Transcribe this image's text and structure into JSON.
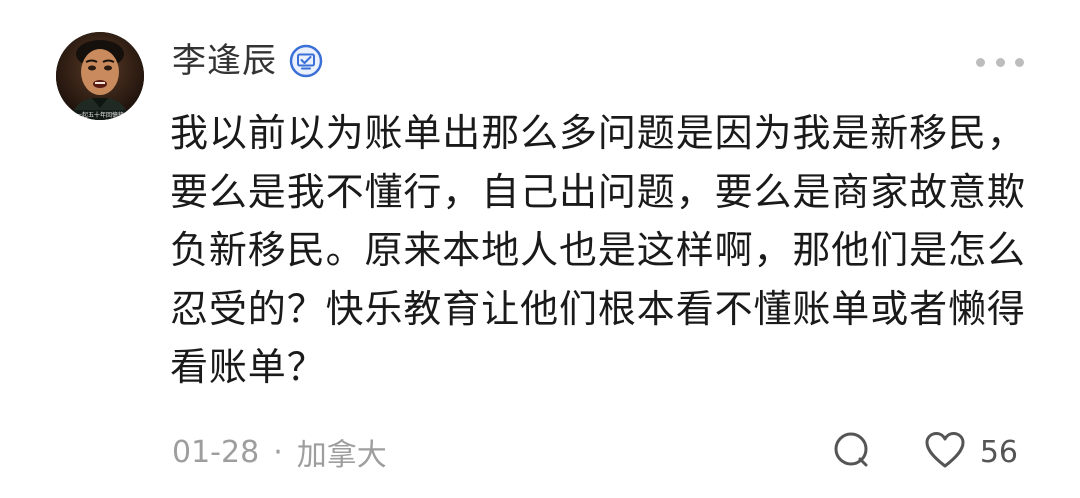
{
  "comment": {
    "author": {
      "name": "李逢辰",
      "verified": true,
      "avatar_caption": "一起五十年回憶錄"
    },
    "body": "我以前以为账单出那么多问题是因为我是新移民，要么是我不懂行，自己出问题，要么是商家故意欺负新移民。原来本地人也是这样啊，那他们是怎么忍受的？快乐教育让他们根本看不懂账单或者懒得看账单？",
    "meta": {
      "date": "01-28",
      "separator": "·",
      "location": "加拿大"
    },
    "actions": {
      "like_count": "56"
    }
  },
  "icons": {
    "verified": "verified-badge-icon",
    "more": "more-dots-icon",
    "reply": "comment-bubble-icon",
    "like": "heart-outline-icon"
  },
  "colors": {
    "text_primary": "#1a1a1a",
    "text_secondary": "#9e9e9e",
    "badge_blue": "#3b6fd8"
  }
}
